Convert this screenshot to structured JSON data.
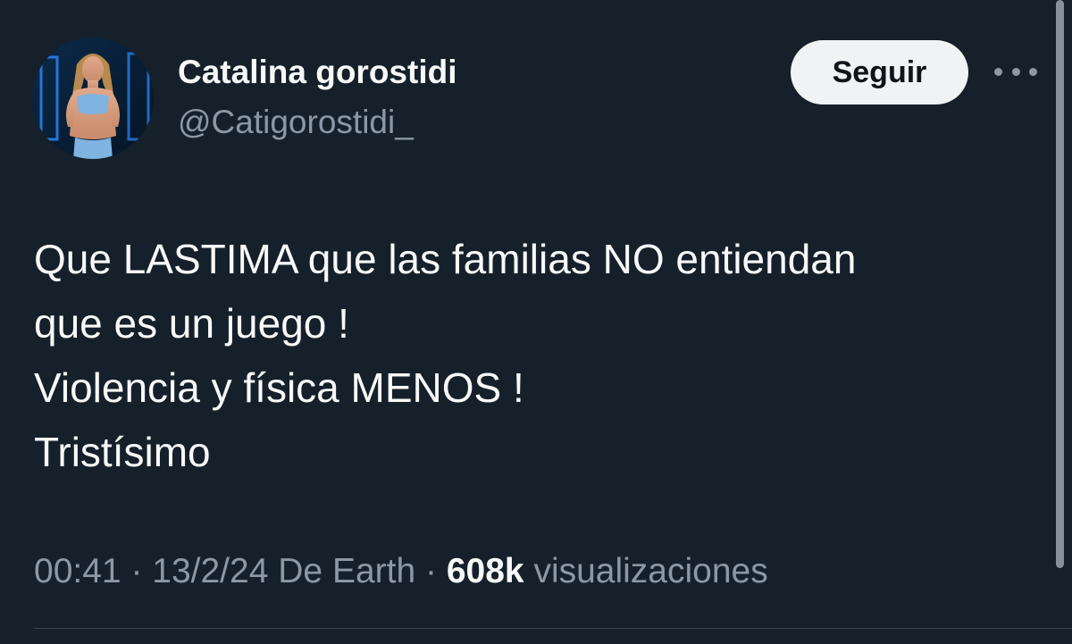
{
  "author": {
    "display_name": "Catalina gorostidi",
    "handle": "@Catigorostidi_"
  },
  "actions": {
    "follow_label": "Seguir",
    "more_icon": "more-horizontal-icon"
  },
  "tweet": {
    "lines": [
      "Que LASTIMA que las familias NO entiendan",
      "que es un juego !",
      "Violencia y física MENOS !",
      "Tristísimo"
    ]
  },
  "meta": {
    "time": "00:41",
    "date": "13/2/24",
    "source": "De Earth",
    "views_count": "608k",
    "views_label": "visualizaciones",
    "separator": " · "
  },
  "colors": {
    "background": "#15202b",
    "primary_text": "#f7f9f9",
    "secondary_text": "#8b98a5",
    "follow_button_bg": "#eff3f4"
  }
}
